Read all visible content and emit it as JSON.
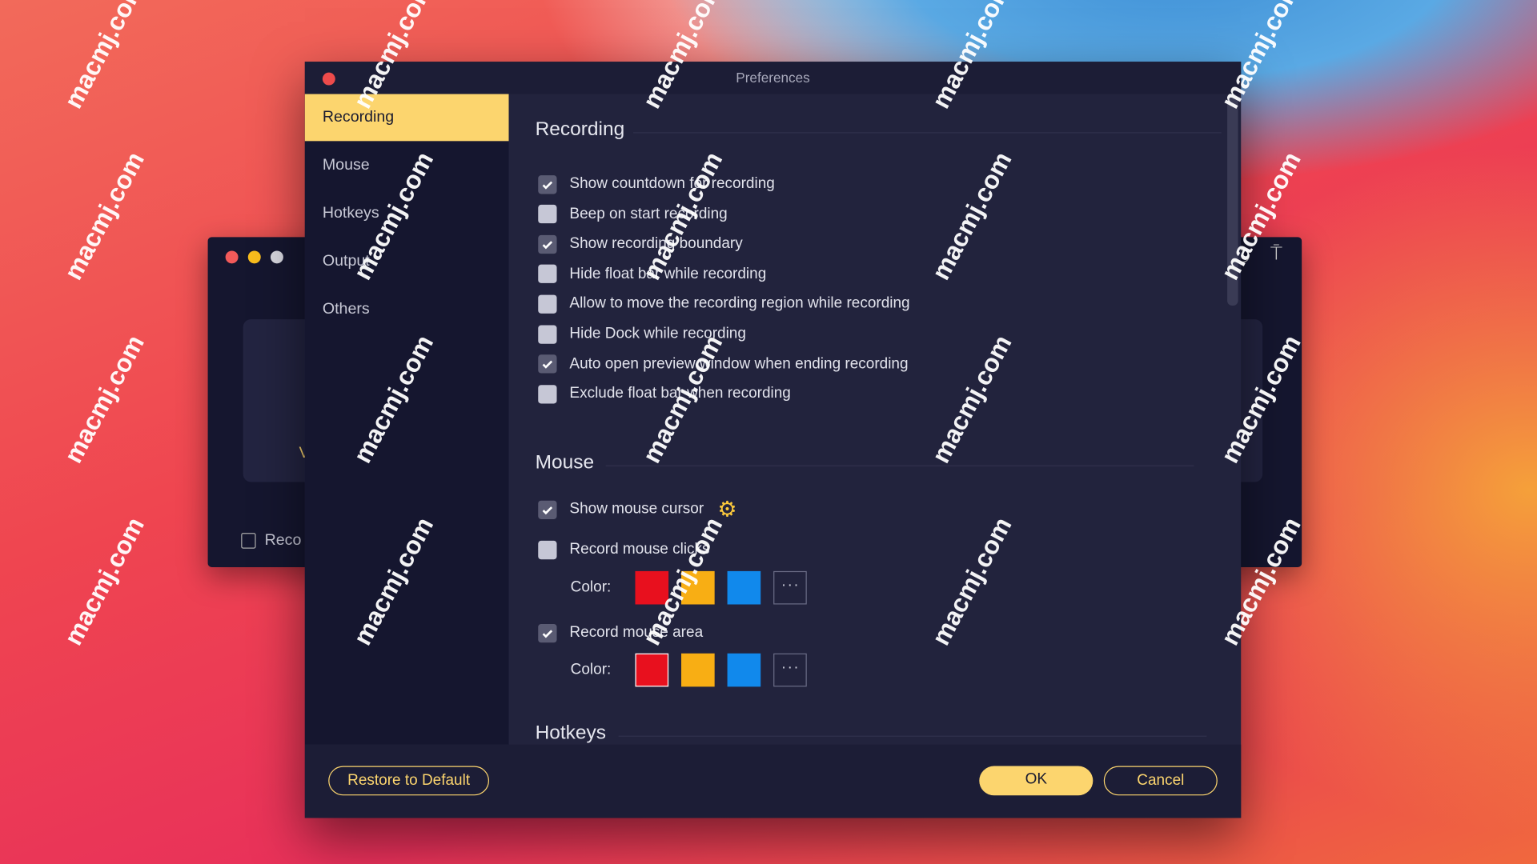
{
  "window_title": "Preferences",
  "back_window": {
    "label": "Reco",
    "partial_char": "V"
  },
  "sidebar": {
    "items": [
      {
        "label": "Recording",
        "selected": true
      },
      {
        "label": "Mouse"
      },
      {
        "label": "Hotkeys"
      },
      {
        "label": "Output"
      },
      {
        "label": "Others"
      }
    ]
  },
  "recording": {
    "title": "Recording",
    "options": [
      {
        "label": "Show countdown for recording",
        "checked": true
      },
      {
        "label": "Beep on start recording",
        "checked": false
      },
      {
        "label": "Show recording boundary",
        "checked": true
      },
      {
        "label": "Hide float bar while recording",
        "checked": false
      },
      {
        "label": "Allow to move the recording region while recording",
        "checked": false
      },
      {
        "label": "Hide Dock while recording",
        "checked": false
      },
      {
        "label": "Auto open preview window when ending recording",
        "checked": true
      },
      {
        "label": "Exclude float bar when recording",
        "checked": false
      }
    ]
  },
  "mouse": {
    "title": "Mouse",
    "show_cursor": {
      "label": "Show mouse cursor",
      "checked": true,
      "icon": "gear-icon"
    },
    "record_clicks": {
      "label": "Record mouse clicks",
      "checked": false,
      "color_label": "Color:"
    },
    "record_area": {
      "label": "Record mouse area",
      "checked": true,
      "color_label": "Color:"
    },
    "colors": [
      "#e8101e",
      "#f8ae14",
      "#1189ec"
    ],
    "more_label": "···"
  },
  "hotkeys": {
    "title": "Hotkeys"
  },
  "footer": {
    "restore": "Restore to Default",
    "ok": "OK",
    "cancel": "Cancel"
  },
  "colors": {
    "accent": "#fcd56e",
    "dialog_bg": "#22233d",
    "sidebar_bg": "#15162f"
  },
  "watermark": "macmj.com"
}
